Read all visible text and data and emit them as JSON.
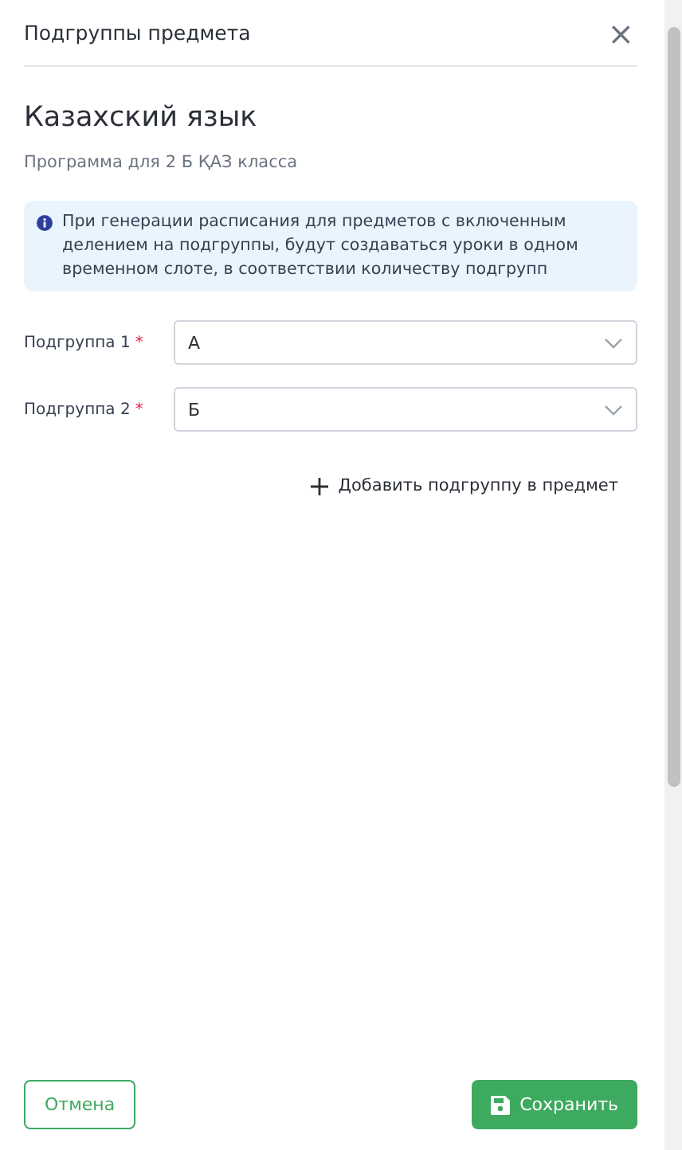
{
  "dialog": {
    "title": "Подгруппы предмета",
    "close": "×"
  },
  "subject": {
    "name": "Казахский язык",
    "program": "Программа для 2 Б ҚАЗ класса"
  },
  "info": "При генерации расписания для предметов с включенным делением на подгруппы, будут создаваться уроки в одном временном слоте, в соответствии количеству подгрупп",
  "subgroups": [
    {
      "label": "Подгруппа 1",
      "required_mark": "*",
      "value": "А"
    },
    {
      "label": "Подгруппа 2",
      "required_mark": "*",
      "value": "Б"
    }
  ],
  "add_button": "Добавить подгруппу в предмет",
  "buttons": {
    "cancel": "Отмена",
    "save": "Сохранить"
  }
}
